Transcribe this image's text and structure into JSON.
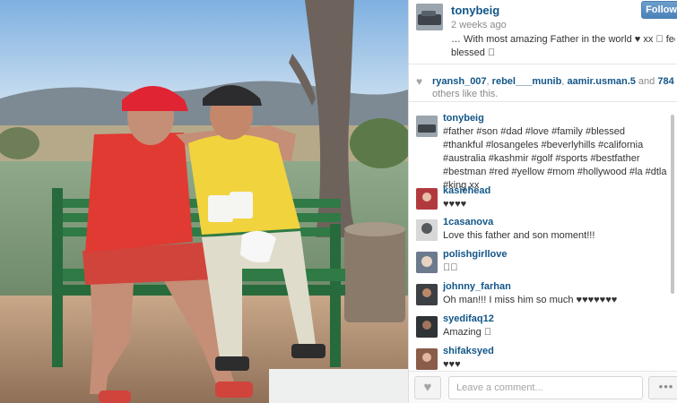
{
  "post": {
    "username": "tonybeig",
    "time_ago": "2 weeks ago",
    "caption_line1": "… With most amazing Father in the world ♥ xx 􀀀 feel so",
    "caption_line2": "blessed 􀀀",
    "follow_label": "Follow",
    "photo_alt": "Father and son on a green bench toasting mugs"
  },
  "likes": {
    "users": [
      "ryansh_007",
      "rebel___munib",
      "aamir.usman.5"
    ],
    "separator": ", ",
    "joiner": " and ",
    "count": "784",
    "suffix": "others like this."
  },
  "comments": [
    {
      "username": "tonybeig",
      "text": "#father #son #dad #love #family #blessed #thankful #losangeles #beverlyhills #california #australia #kashmir #golf #sports #bestfather #bestman #red #yellow #mom #hollywood #la #dtla #king xx",
      "avatar_color": "#7f8587"
    },
    {
      "username": "kasiehead",
      "text": "♥♥♥♥",
      "avatar_color": "#b23a3f"
    },
    {
      "username": "1casanova",
      "text": "Love this father and son moment!!!",
      "avatar_color": "#55595c"
    },
    {
      "username": "polishgirllove",
      "text": "􀀀􀀀",
      "avatar_color": "#6c7a8e"
    },
    {
      "username": "johnny_farhan",
      "text": "Oh man!!! I miss him so much ♥♥♥♥♥♥♥",
      "avatar_color": "#3c3f44"
    },
    {
      "username": "syedifaq12",
      "text": "Amazing 􀀀",
      "avatar_color": "#2f3336"
    },
    {
      "username": "shifaksyed",
      "text": "♥♥♥",
      "avatar_color": "#8a5c4a"
    }
  ],
  "footer": {
    "comment_placeholder": "Leave a comment...",
    "more_label": "•••"
  },
  "icons": {
    "heart": "heart-icon",
    "like_button": "heart-outline-icon",
    "more": "ellipsis-icon"
  },
  "colors": {
    "link_blue": "#125688",
    "follow_blue": "#4a82b8",
    "muted": "#8a8a8a"
  }
}
